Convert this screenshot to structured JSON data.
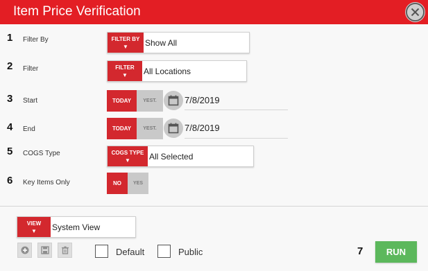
{
  "dialog": {
    "title": "Item Price Verification"
  },
  "rows": [
    {
      "num": "1",
      "label": "Filter By",
      "btn": "FILTER BY",
      "value": "Show All"
    },
    {
      "num": "2",
      "label": "Filter",
      "btn": "FILTER",
      "value": "All Locations"
    },
    {
      "num": "3",
      "label": "Start",
      "on": "TODAY",
      "off": "YEST.",
      "date": "7/8/2019"
    },
    {
      "num": "4",
      "label": "End",
      "on": "TODAY",
      "off": "YEST.",
      "date": "7/8/2019"
    },
    {
      "num": "5",
      "label": "COGS Type",
      "btn": "COGS TYPE",
      "value": "All Selected"
    },
    {
      "num": "6",
      "label": "Key Items Only",
      "on": "NO",
      "off": "YES"
    }
  ],
  "arrow": "▼",
  "view": {
    "btn": "VIEW",
    "value": "System View"
  },
  "options": {
    "default_label": "Default",
    "public_label": "Public"
  },
  "run": {
    "num": "7",
    "label": "RUN"
  },
  "icons": {
    "close": "close-icon",
    "calendar": "calendar-icon",
    "add": "add-icon",
    "save": "save-icon",
    "delete": "trash-icon"
  },
  "colors": {
    "title_bar": "#e31e24",
    "accent_red": "#d3282e",
    "run_green": "#5cb85c",
    "toggle_off": "#c9c9c9"
  }
}
